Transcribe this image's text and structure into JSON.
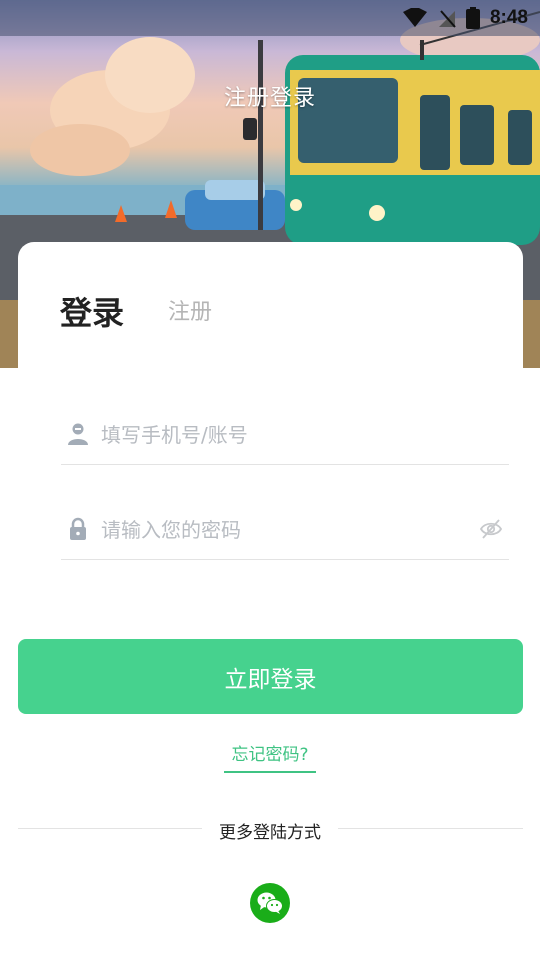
{
  "status_bar": {
    "time": "8:48"
  },
  "header": {
    "title": "注册登录"
  },
  "tabs": {
    "login": "登录",
    "register": "注册"
  },
  "form": {
    "account_placeholder": "填写手机号/账号",
    "account_value": "",
    "password_placeholder": "请输入您的密码",
    "password_value": ""
  },
  "actions": {
    "login_button": "立即登录",
    "forgot_password": "忘记密码?"
  },
  "more_login": {
    "label": "更多登陆方式"
  },
  "colors": {
    "accent": "#46d28e",
    "link": "#3fc383",
    "wechat": "#1aad19"
  },
  "icons": [
    "wifi-icon",
    "signal-icon",
    "battery-icon",
    "user-icon",
    "lock-icon",
    "eye-off-icon",
    "wechat-icon"
  ]
}
